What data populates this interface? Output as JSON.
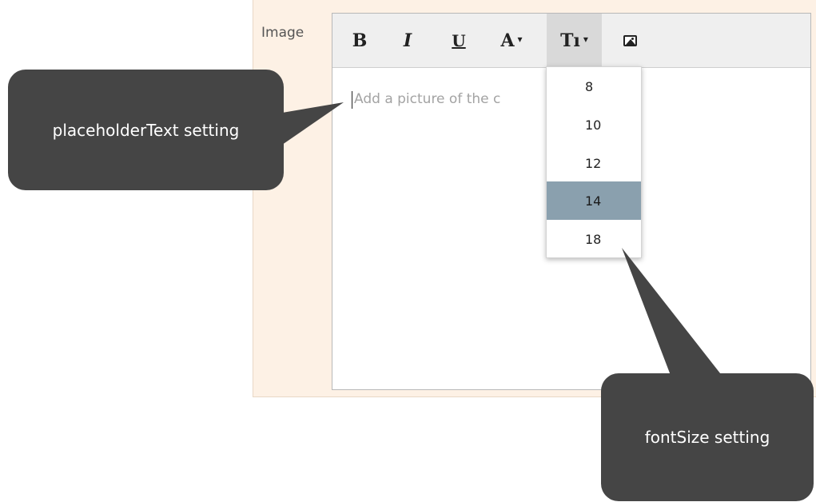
{
  "field": {
    "label": "Image"
  },
  "toolbar": {
    "bold_label": "B",
    "italic_label": "I",
    "underline_label": "U",
    "font_color_label": "A",
    "font_size_label": "Tı",
    "caret": "▾",
    "image_icon": "image-icon"
  },
  "editor": {
    "placeholder": "Add a picture of the c"
  },
  "font_size_dropdown": {
    "options": [
      "8",
      "10",
      "12",
      "14",
      "18"
    ],
    "selected": "14",
    "highlight_color": "#8aa0ae"
  },
  "callouts": {
    "placeholder_text": "placeholderText setting",
    "font_size": "fontSize setting",
    "color": "#454545"
  }
}
